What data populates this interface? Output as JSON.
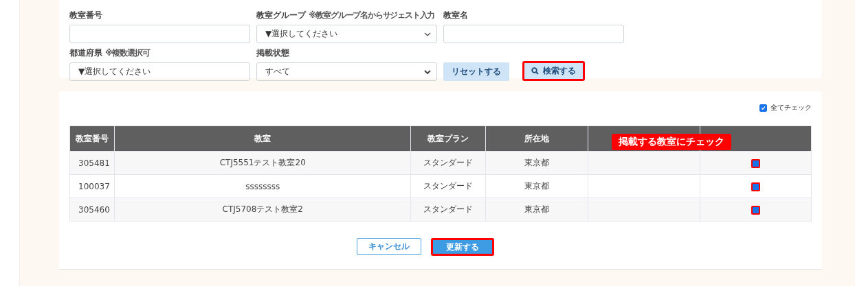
{
  "search_form": {
    "classroom_number": {
      "label": "教室番号"
    },
    "classroom_group": {
      "label": "教室グループ",
      "note": "※教室グループ名からサジェスト入力",
      "value": "▼選択してください"
    },
    "classroom_name": {
      "label": "教室名"
    },
    "prefecture": {
      "label": "都道府県",
      "note": "※複数選択可",
      "value": "▼選択してください"
    },
    "listing_status": {
      "label": "掲載状態",
      "value": "すべて"
    },
    "reset_button": "リセットする",
    "search_button": {
      "label": "検索する",
      "highlighted": true
    }
  },
  "table": {
    "check_all": {
      "label": "全てチェック",
      "checked": true
    },
    "columns": [
      "教室番号",
      "教室",
      "教室プラン",
      "所在地"
    ],
    "rows": [
      {
        "number": "305481",
        "name": "CTJ5551テスト教室20",
        "plan": "スタンダード",
        "location": "東京都",
        "checked": true
      },
      {
        "number": "100037",
        "name": "ssssssss",
        "plan": "スタンダード",
        "location": "東京都",
        "checked": true
      },
      {
        "number": "305460",
        "name": "CTJ5708テスト教室2",
        "plan": "スタンダード",
        "location": "東京都",
        "checked": true
      }
    ],
    "callout": "掲載する教室にチェック"
  },
  "cancel_button": "キャンセル",
  "update_button": {
    "label": "更新する",
    "highlighted": true
  }
}
